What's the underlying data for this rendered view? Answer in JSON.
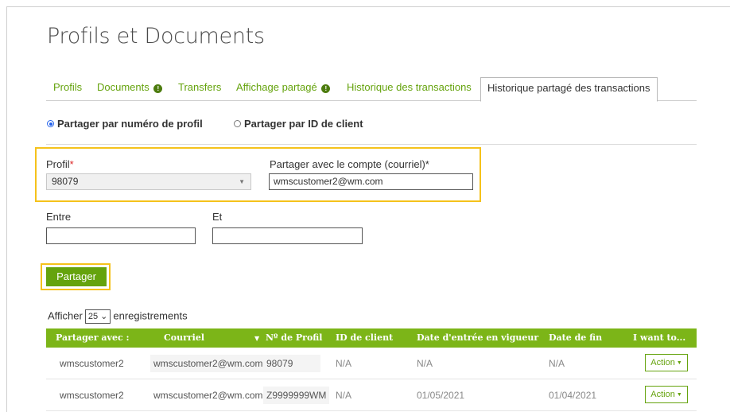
{
  "page": {
    "title": "Profils et Documents"
  },
  "tabs": [
    {
      "label": "Profils",
      "badge": ""
    },
    {
      "label": "Documents",
      "badge": "!"
    },
    {
      "label": "Transfers",
      "badge": ""
    },
    {
      "label": "Affichage partagé",
      "badge": "!"
    },
    {
      "label": "Historique des transactions",
      "badge": ""
    },
    {
      "label": "Historique partagé des transactions",
      "badge": "",
      "active": true
    }
  ],
  "share_mode": {
    "by_profile": {
      "label": "Partager par numéro de profil",
      "checked": true
    },
    "by_client": {
      "label": "Partager par ID de client",
      "checked": false
    }
  },
  "form": {
    "profile_label": "Profil",
    "required_mark": "*",
    "profile_value": "98079",
    "share_with_label": "Partager avec le compte (courriel)*",
    "share_with_value": "wmscustomer2@wm.com",
    "between_label": "Entre",
    "and_label": "Et",
    "between_value": "",
    "and_value": "",
    "submit_label": "Partager"
  },
  "show": {
    "prefix": "Afficher",
    "value": "25",
    "suffix": "enregistrements"
  },
  "table": {
    "headers": {
      "share_with": "Partager avec :",
      "email": "Courriel",
      "sort_icon": "▼",
      "profile_no": "Nº de Profil",
      "client_id": "ID de client",
      "start_date": "Date d'entrée en vigueur",
      "end_date": "Date de fin",
      "actions": "I want to..."
    },
    "rows": [
      {
        "share_with": "wmscustomer2",
        "email": "wmscustomer2@wm.com",
        "profile_no": "98079",
        "client_id": "N/A",
        "start_date": "N/A",
        "end_date": "N/A",
        "action": "Action"
      },
      {
        "share_with": "wmscustomer2",
        "email": "wmscustomer2@wm.com",
        "profile_no": "Z9999999WM",
        "client_id": "N/A",
        "start_date": "01/05/2021",
        "end_date": "01/04/2021",
        "action": "Action"
      }
    ]
  },
  "colors": {
    "accent": "#65a30d",
    "header_bg": "#7cb518",
    "highlight": "#f5c21b"
  }
}
